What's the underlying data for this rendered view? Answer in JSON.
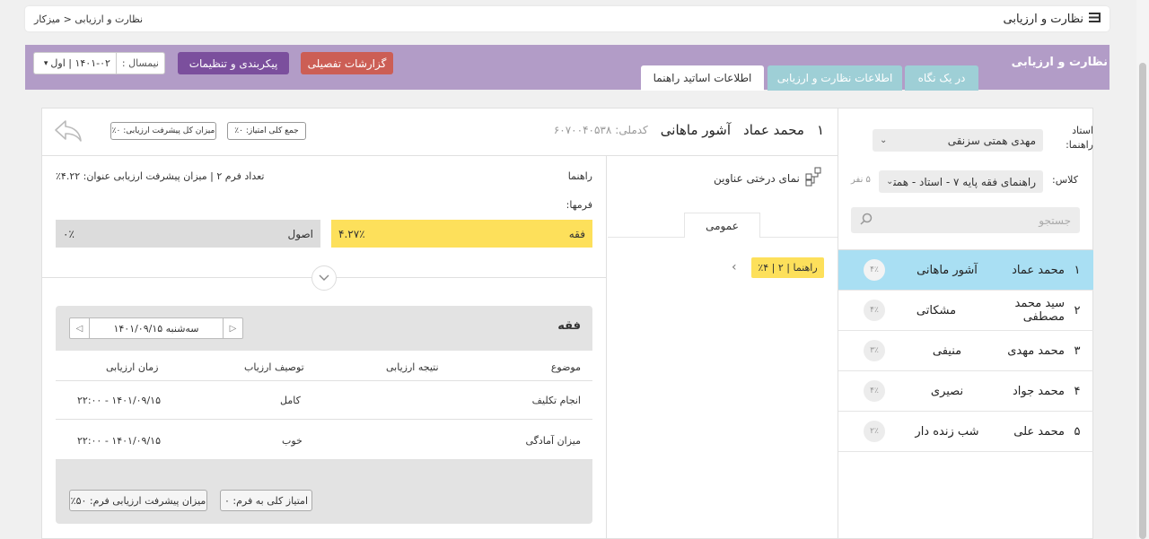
{
  "topbar": {
    "title": "نظارت و ارزیابی",
    "breadcrumb": "نظارت و ارزیابی  <  میزکار",
    "menu_icon": "menu-icon"
  },
  "header": {
    "title": "نظارت و ارزیابی",
    "tabs": [
      {
        "label": "در یک نگاه",
        "active": false
      },
      {
        "label": "اطلاعات نظارت و ارزیابی",
        "active": false
      },
      {
        "label": "اطلاعات اساتید راهنما",
        "active": true
      }
    ],
    "detail_report": "گزارشات تفصیلی",
    "settings": "پیکربندی و تنظیمات",
    "semester_label": "نیمسال :",
    "semester_value": "۱۴۰۱-۰۲ | اول"
  },
  "filters": {
    "teacher_label": "استاد راهنما:",
    "teacher_value": "مهدی همتی سزنقی",
    "class_label": "کلاس:",
    "class_value": "راهنمای فقه پایه ۷ - استاد - همتی",
    "count": "۵ نفر",
    "search_placeholder": "جستجو"
  },
  "students": [
    {
      "num": "۱",
      "first": "محمد عماد",
      "last": "آشور ماهانی",
      "pct": "۴٪",
      "active": true
    },
    {
      "num": "۲",
      "first": "سید محمد مصطفی",
      "last": "مشکاتی",
      "pct": "۴٪",
      "active": false
    },
    {
      "num": "۳",
      "first": "محمد مهدی",
      "last": "منیفی",
      "pct": "۳٪",
      "active": false
    },
    {
      "num": "۴",
      "first": "محمد جواد",
      "last": "نصیری",
      "pct": "۴٪",
      "active": false
    },
    {
      "num": "۵",
      "first": "محمد علی",
      "last": "شب زنده دار",
      "pct": "۲٪",
      "active": false
    }
  ],
  "detail": {
    "num": "۱",
    "first": "محمد عماد",
    "last": "آشور ماهانی",
    "national_label": "کدملی:",
    "national_value": "۶۰۷۰۰۴۰۵۳۸",
    "total_score": "جمع کلی امتیاز: ۰٪",
    "total_progress": "میزان کل پیشرفت ارزیابی: ۰٪",
    "tree_label": "نمای درختی عناوین",
    "general_tab": "عمومی",
    "tag": "راهنما | ۲ | ۴٪",
    "section_title": "راهنما",
    "form_info": "تعداد فرم ۲ | میزان پیشرفت ارزیابی عنوان: ۴.۲۲٪",
    "forms_label": "فرمها:",
    "forms": [
      {
        "name": "فقه",
        "pct": "۴.۲۷٪",
        "progress": 0.0427
      },
      {
        "name": "اصول",
        "pct": "۰٪",
        "progress": 0
      }
    ]
  },
  "form_panel": {
    "title": "فقه",
    "date": "سه‌شنبه  ۱۴۰۱/۰۹/۱۵",
    "columns": [
      "موضوع",
      "نتیجه ارزیابی",
      "توصیف ارزیاب",
      "زمان ارزیابی"
    ],
    "rows": [
      {
        "subject": "انجام تکلیف",
        "result": "",
        "desc": "کامل",
        "time": "۱۴۰۱/۰۹/۱۵ - ۲۲:۰۰"
      },
      {
        "subject": "میزان آمادگی",
        "result": "",
        "desc": "خوب",
        "time": "۱۴۰۱/۰۹/۱۵ - ۲۲:۰۰"
      }
    ],
    "score_btn": "امتیاز کلی به فرم: ۰",
    "progress_btn": "میزان پیشرفت ارزیابی فرم: ۵۰٪"
  },
  "colors": {
    "purple": "#b29cc7",
    "tab": "#9ecfd6",
    "red": "#cc5e55",
    "btn_purple": "#7b4f9d",
    "active_row": "#a9dff3",
    "yellow": "#fde05b"
  }
}
